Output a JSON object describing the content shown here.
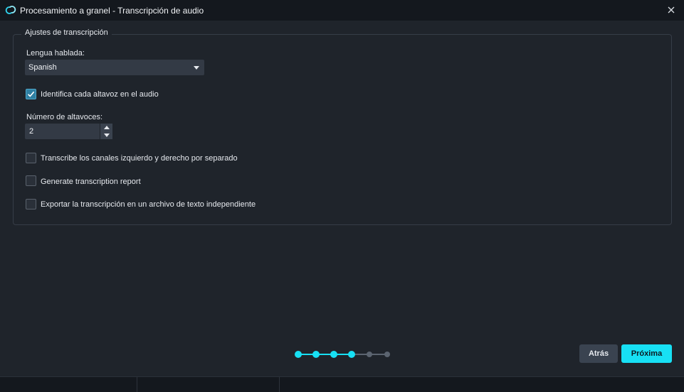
{
  "window": {
    "title": "Procesamiento a granel - Transcripción de audio",
    "app_icon": "sync-logo-icon",
    "close_icon": "close-icon"
  },
  "group": {
    "legend": "Ajustes de transcripción"
  },
  "language": {
    "label": "Lengua hablada:",
    "selected": "Spanish",
    "icon": "chevron-down-icon"
  },
  "options": {
    "identify_speakers": {
      "label": "Identifica cada altavoz en el audio",
      "checked": true
    },
    "separate_channels": {
      "label": "Transcribe los canales izquierdo y derecho por separado",
      "checked": false
    },
    "report": {
      "label": "Generate transcription report",
      "checked": false
    },
    "export_text": {
      "label": "Exportar la transcripción en un archivo de texto independiente",
      "checked": false
    }
  },
  "speakers": {
    "label": "Número de altavoces:",
    "value": "2"
  },
  "progress": {
    "total_steps": 6,
    "completed_steps": 4,
    "active_color": "#17e0f4",
    "inactive_color": "#5b6470"
  },
  "buttons": {
    "back": "Atrás",
    "next": "Próxima"
  },
  "colors": {
    "accent": "#17e0f4",
    "background": "#1f242b",
    "titlebar": "#14181e"
  }
}
